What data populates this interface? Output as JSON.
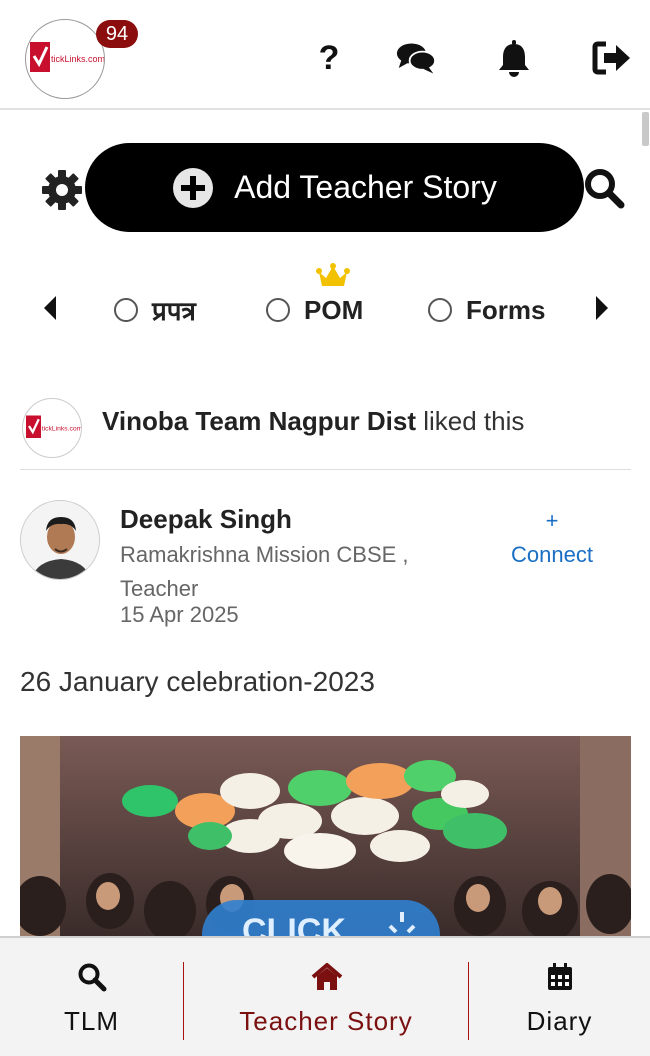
{
  "header": {
    "logo_text": "tickLinks.com",
    "notification_count": "94",
    "icons": [
      "help-icon",
      "chat-icon",
      "bell-icon",
      "logout-icon"
    ],
    "help_glyph": "?"
  },
  "actions": {
    "add_story_label": "Add Teacher Story",
    "icons": [
      "gear-icon",
      "plus-circle-icon",
      "search-icon"
    ]
  },
  "filters": {
    "options": [
      {
        "label": "प्रपत्र",
        "selected": false
      },
      {
        "label": "POM",
        "selected": false,
        "badge_icon": "crown-icon"
      },
      {
        "label": "Forms",
        "selected": false
      }
    ]
  },
  "feed": {
    "liked_by": "Vinoba Team Nagpur Dist",
    "liked_suffix": "liked this",
    "post": {
      "author": "Deepak Singh",
      "school": "Ramakrishna Mission CBSE ,",
      "role": "Teacher",
      "date": "15 Apr 2025",
      "connect_plus": "+",
      "connect_label": "Connect",
      "title": "26 January celebration-2023",
      "image_overlay_text": "CLICK"
    }
  },
  "bottom_nav": {
    "items": [
      {
        "label": "TLM",
        "icon": "search-icon",
        "active": false
      },
      {
        "label": "Teacher Story",
        "icon": "home-icon",
        "active": true
      },
      {
        "label": "Diary",
        "icon": "calendar-icon",
        "active": false
      }
    ]
  },
  "colors": {
    "badge": "#8b0d0d",
    "primary_button": "#000000",
    "link": "#1a6fc4",
    "active_nav": "#7a1010",
    "crown": "#f2c200"
  }
}
